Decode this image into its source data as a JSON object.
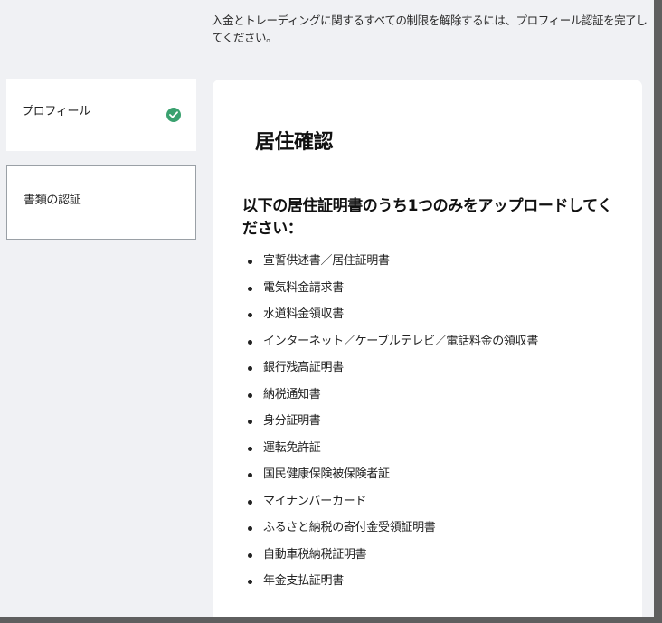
{
  "intro_text": "入金とトレーディングに関するすべての制限を解除するには、プロフィール認証を完了してください。",
  "sidebar": {
    "items": [
      {
        "label": "プロフィール",
        "completed": true
      },
      {
        "label": "書類の認証",
        "selected": true
      }
    ]
  },
  "card": {
    "title": "居住確認",
    "heading": "以下の居住証明書のうち1つのみをアップロードしてください：",
    "documents": [
      "宣誓供述書／居住証明書",
      "電気料金請求書",
      "水道料金領収書",
      "インターネット／ケーブルテレビ／電話料金の領収書",
      "銀行残高証明書",
      "納税通知書",
      "身分証明書",
      "運転免許証",
      "国民健康保険被保険者証",
      "マイナンバーカード",
      "ふるさと納税の寄付金受領証明書",
      "自動車税納税証明書",
      "年金支払証明書"
    ]
  },
  "colors": {
    "check_green": "#3aa16f",
    "page_bg": "#f0f1f4",
    "card_bg": "#ffffff"
  }
}
